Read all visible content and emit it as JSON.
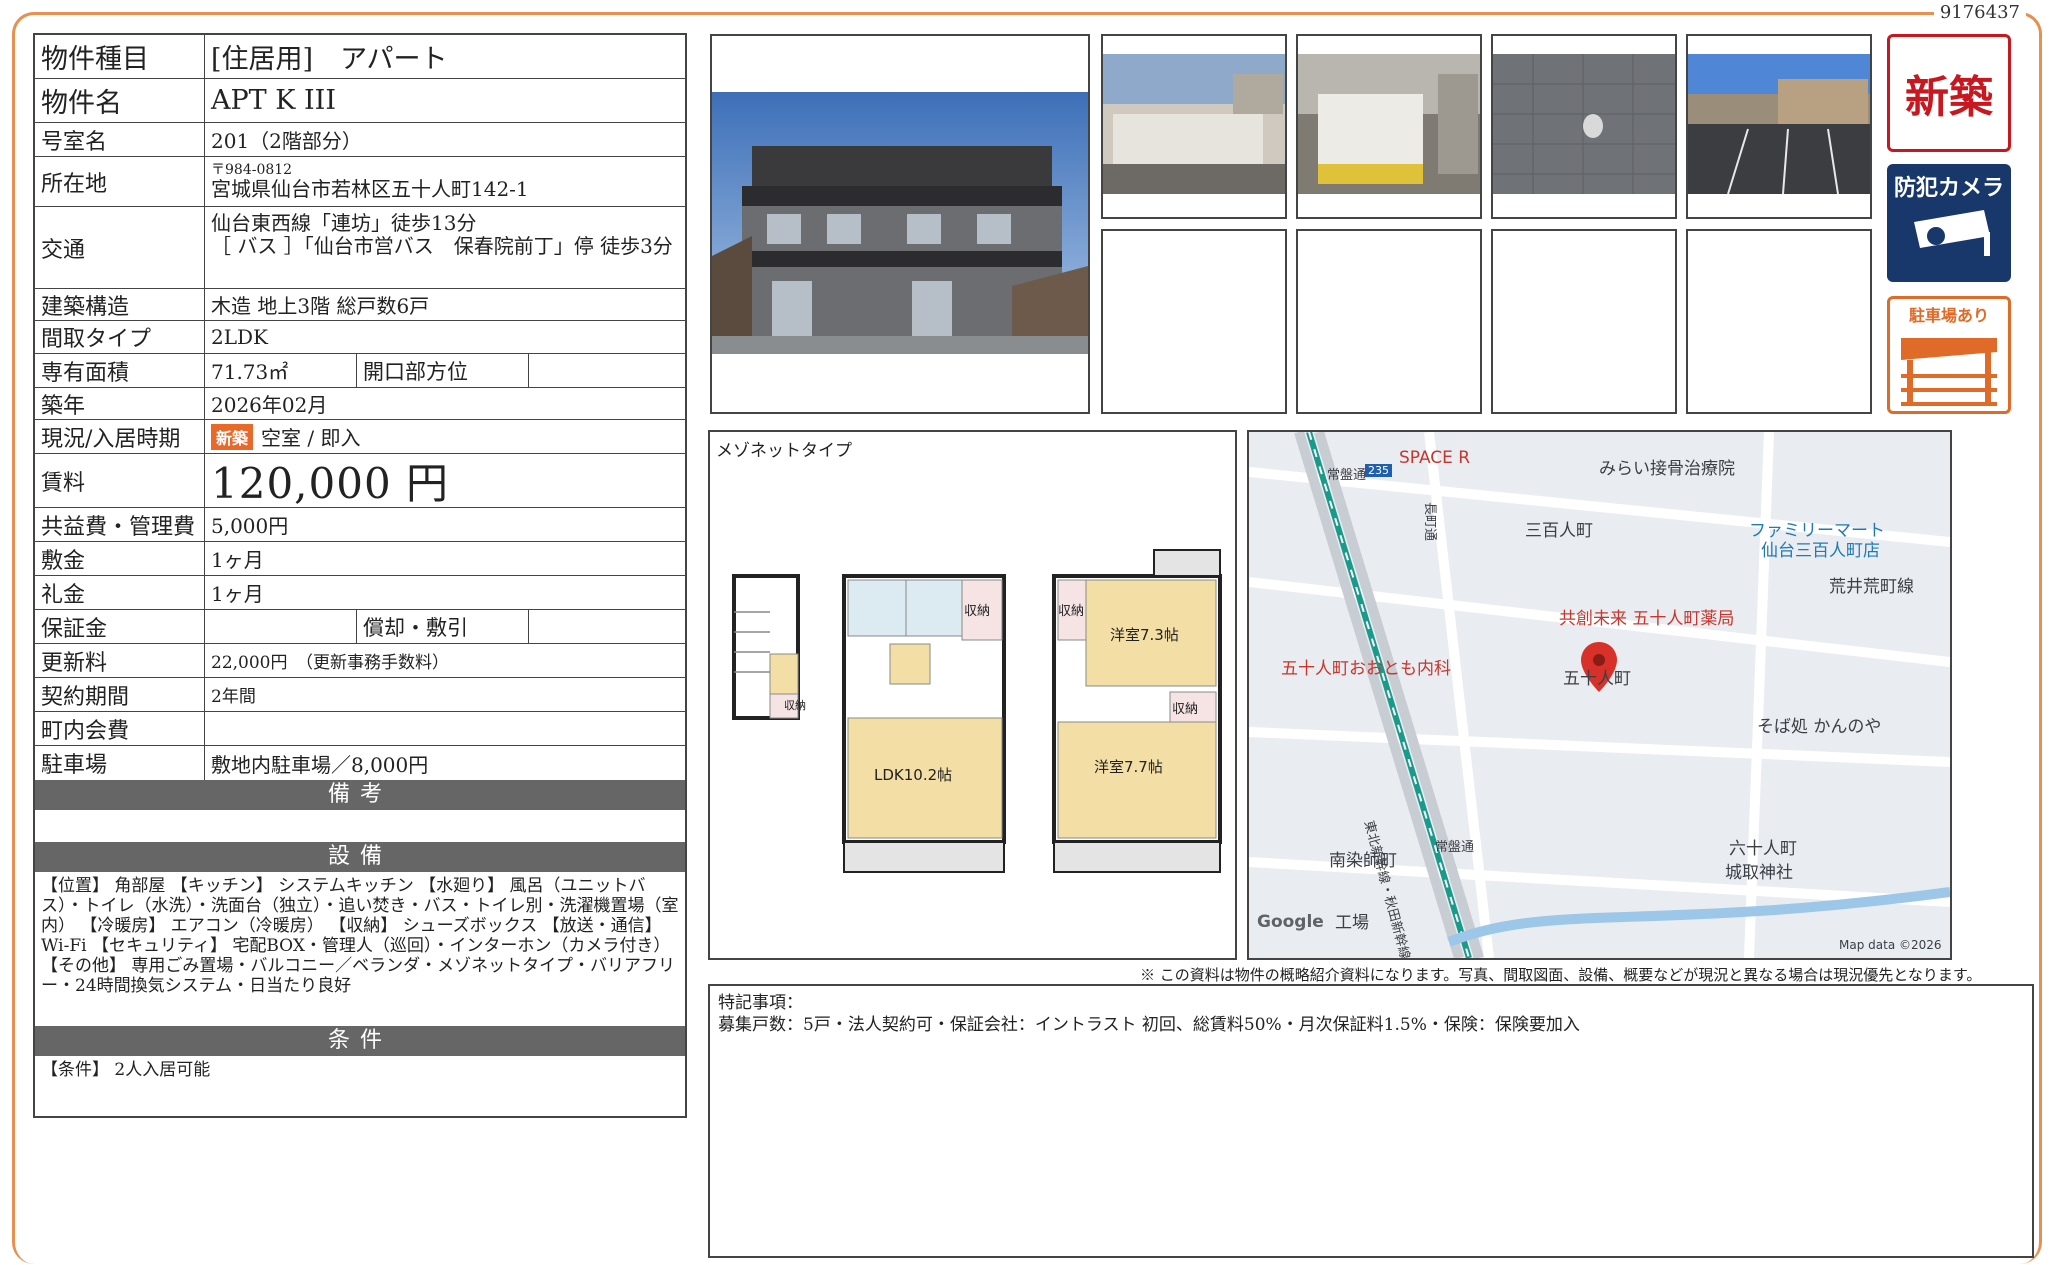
{
  "doc_id": "9176437",
  "spec": {
    "type_label": "物件種目",
    "type_value": "[住居用]　アパート",
    "name_label": "物件名",
    "name_value": "APT K III",
    "room_label": "号室名",
    "room_value": "201（2階部分）",
    "address_label": "所在地",
    "postal": "〒984-0812",
    "address_value": "宮城県仙台市若林区五十人町142-1",
    "access_label": "交通",
    "access_line1": "仙台東西線「連坊」徒歩13分",
    "access_line2": "［ バス ］「仙台市営バス　保春院前丁」停 徒歩3分",
    "structure_label": "建築構造",
    "structure_value": "木造 地上3階 総戸数6戸",
    "layout_label": "間取タイプ",
    "layout_value": "2LDK",
    "area_label": "専有面積",
    "area_value": "71.73㎡",
    "direction_label": "開口部方位",
    "direction_value": "",
    "built_label": "築年",
    "built_value": "2026年02月",
    "status_label": "現況/入居時期",
    "status_badge": "新築",
    "status_value": "空室 / 即入",
    "rent_label": "賃料",
    "rent_value": "120,000 円",
    "fee_label": "共益費・管理費",
    "fee_value": "5,000円",
    "deposit_label": "敷金",
    "deposit_value": "1ヶ月",
    "key_label": "礼金",
    "key_value": "1ヶ月",
    "guarantee_label": "保証金",
    "guarantee_value": "",
    "amort_label": "償却・敷引",
    "amort_value": "",
    "renewal_label": "更新料",
    "renewal_value": "22,000円　（更新事務手数料）",
    "contract_label": "契約期間",
    "contract_value": "2年間",
    "assoc_label": "町内会費",
    "assoc_value": "",
    "parking_label": "駐車場",
    "parking_value": "敷地内駐車場／8,000円"
  },
  "sections": {
    "remarks_title": "備考",
    "remarks_body": "",
    "equipment_title": "設備",
    "equipment_body": "【位置】 角部屋 【キッチン】 システムキッチン 【水廻り】 風呂（ユニットバス）・トイレ（水洗）・洗面台（独立）・追い焚き・バス・トイレ別・洗濯機置場（室内） 【冷暖房】 エアコン（冷暖房） 【収納】 シューズボックス 【放送・通信】 Wi-Fi 【セキュリティ】 宅配BOX・管理人（巡回）・インターホン（カメラ付き） 【その他】 専用ごみ置場・バルコニー／ベランダ・メゾネットタイプ・バリアフリー・24時間換気システム・日当たり良好",
    "conditions_title": "条件",
    "conditions_body": "【条件】 2人入居可能"
  },
  "icons": {
    "new_label": "新築",
    "camera_label": "防犯カメラ",
    "parking_label": "駐車場あり"
  },
  "floorplan": {
    "title": "メゾネットタイプ",
    "storage": "収納",
    "ldk": "LDK10.2帖",
    "western1": "洋室7.3帖",
    "western2": "洋室7.7帖"
  },
  "map": {
    "labels": [
      "SPACE R",
      "みらい接骨治療院",
      "三百人町",
      "ファミリーマート",
      "仙台三百人町店",
      "荒井荒町線",
      "共創未来 五十人町薬局",
      "五十人町おおとも内科",
      "五十人町",
      "そば処 かんのや",
      "六十人町",
      "城取神社",
      "南染師町",
      "工場",
      "Google",
      "Map data ©2026",
      "235",
      "常盤通",
      "東北新幹線・秋田新幹線",
      "長町通",
      "常盤通"
    ]
  },
  "disclaimer": "※ この資料は物件の概略紹介資料になります。写真、間取図面、設備、概要などが現況と異なる場合は現況優先となります。",
  "special": {
    "title": "特記事項：",
    "body": "募集戸数：5戸・法人契約可・保証会社：イントラスト 初回、総賃料50%・月次保証料1.5%・保険：保険要加入"
  }
}
